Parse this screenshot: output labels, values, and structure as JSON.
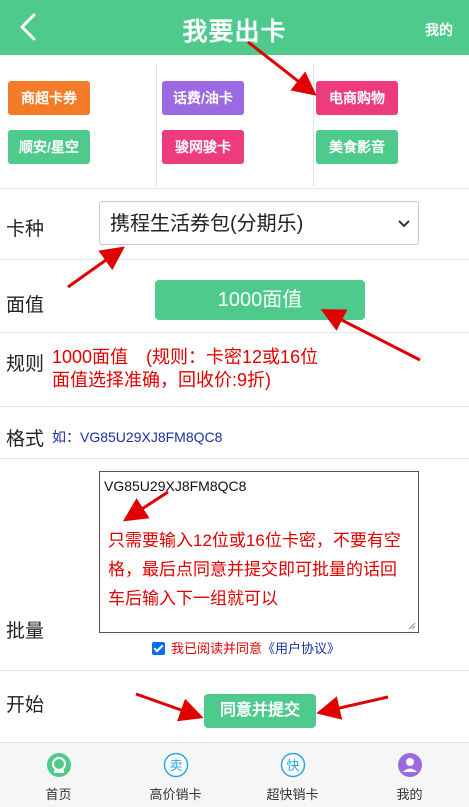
{
  "header": {
    "title": "我要出卡",
    "right_link": "我的",
    "back_icon": "chevron-left-icon"
  },
  "categories": [
    {
      "label": "商超卡券",
      "color": "#f47c28"
    },
    {
      "label": "话费/油卡",
      "color": "#9b6ae0"
    },
    {
      "label": "电商购物",
      "color": "#ee3b7f"
    },
    {
      "label": "顺安/星空",
      "color": "#4ecb8c"
    },
    {
      "label": "骏网骏卡",
      "color": "#ee3b7f"
    },
    {
      "label": "美食影音",
      "color": "#4ecb8c"
    }
  ],
  "form": {
    "card_type_label": "卡种",
    "card_type_value": "携程生活券包(分期乐)",
    "denom_label": "面值",
    "denom_value": "1000面值",
    "rule_label": "规则",
    "rule_line1": "1000面值　(规则：卡密12或16位",
    "rule_line2": "面值选择准确，回收价:9折)",
    "format_label": "格式",
    "format_value": "如：VG85U29XJ8FM8QC8",
    "batch_label": "批量",
    "batch_value": "VG85U29XJ8FM8QC8",
    "batch_tip": "只需要输入12位或16位卡密，不要有空格，最后点同意并提交即可批量的话回车后输入下一组就可以",
    "agree_text": "我已阅读并同意",
    "agree_link": "《用户协议》",
    "agree_checked": true,
    "start_label": "开始",
    "submit_label": "同意并提交"
  },
  "tabbar": [
    {
      "label": "首页",
      "icon": "home-icon"
    },
    {
      "label": "高价销卡",
      "icon": "sell-icon",
      "glyph": "卖"
    },
    {
      "label": "超快销卡",
      "icon": "fast-icon",
      "glyph": "快"
    },
    {
      "label": "我的",
      "icon": "user-icon"
    }
  ],
  "colors": {
    "primary": "#4ecb8c",
    "annotation_red": "#e00000",
    "link_blue": "#1a2fa3"
  }
}
